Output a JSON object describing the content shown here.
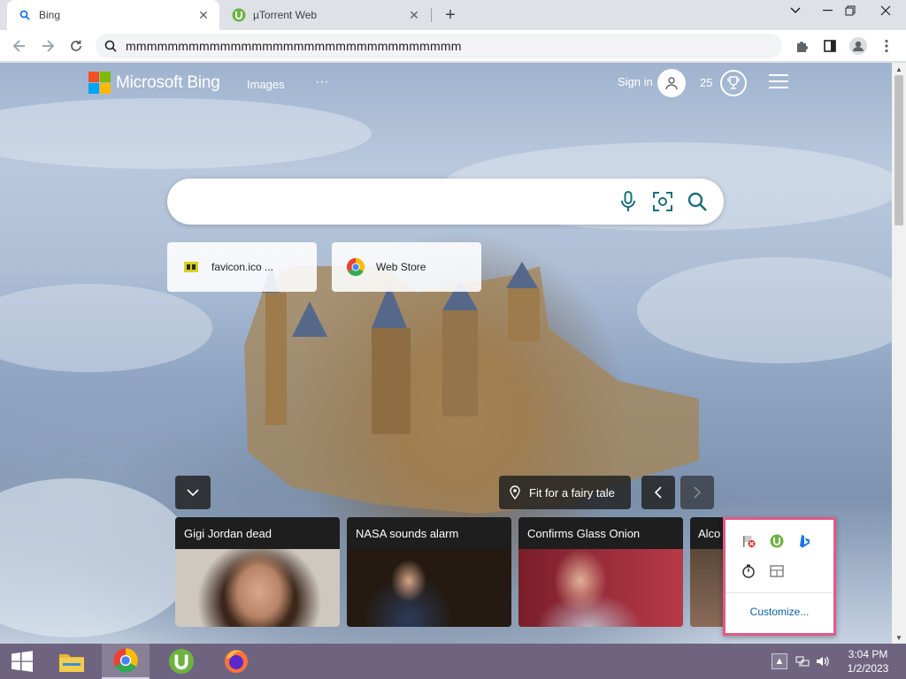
{
  "browser": {
    "tabs": [
      {
        "title": "Bing",
        "favicon": "bing-search-icon",
        "active": true
      },
      {
        "title": "µTorrent Web",
        "favicon": "utorrent-icon",
        "active": false
      }
    ],
    "address": "mmmmmmmmmmmmmmmmmmmmmmmmmmmmmmmm"
  },
  "bing": {
    "logo_text": "Microsoft Bing",
    "nav": {
      "images": "Images",
      "more": "···"
    },
    "sign_in": "Sign in",
    "points": "25",
    "tiles": [
      {
        "label": "favicon.ico ..."
      },
      {
        "label": "Web Store"
      }
    ],
    "image_caption": "Fit for a fairy tale",
    "news": [
      {
        "headline": "Gigi Jordan dead"
      },
      {
        "headline": "NASA sounds alarm"
      },
      {
        "headline": "Confirms Glass Onion"
      },
      {
        "headline": "Alco"
      }
    ]
  },
  "tray_popup": {
    "customize": "Customize..."
  },
  "taskbar": {
    "time": "3:04 PM",
    "date": "1/2/2023"
  },
  "colors": {
    "ms_red": "#f25022",
    "ms_green": "#7fba00",
    "ms_blue": "#00a4ef",
    "ms_yellow": "#ffb900",
    "bing_teal": "#1a6e7a",
    "taskbar": "#6e6480",
    "popup_border": "#e15a8a"
  }
}
